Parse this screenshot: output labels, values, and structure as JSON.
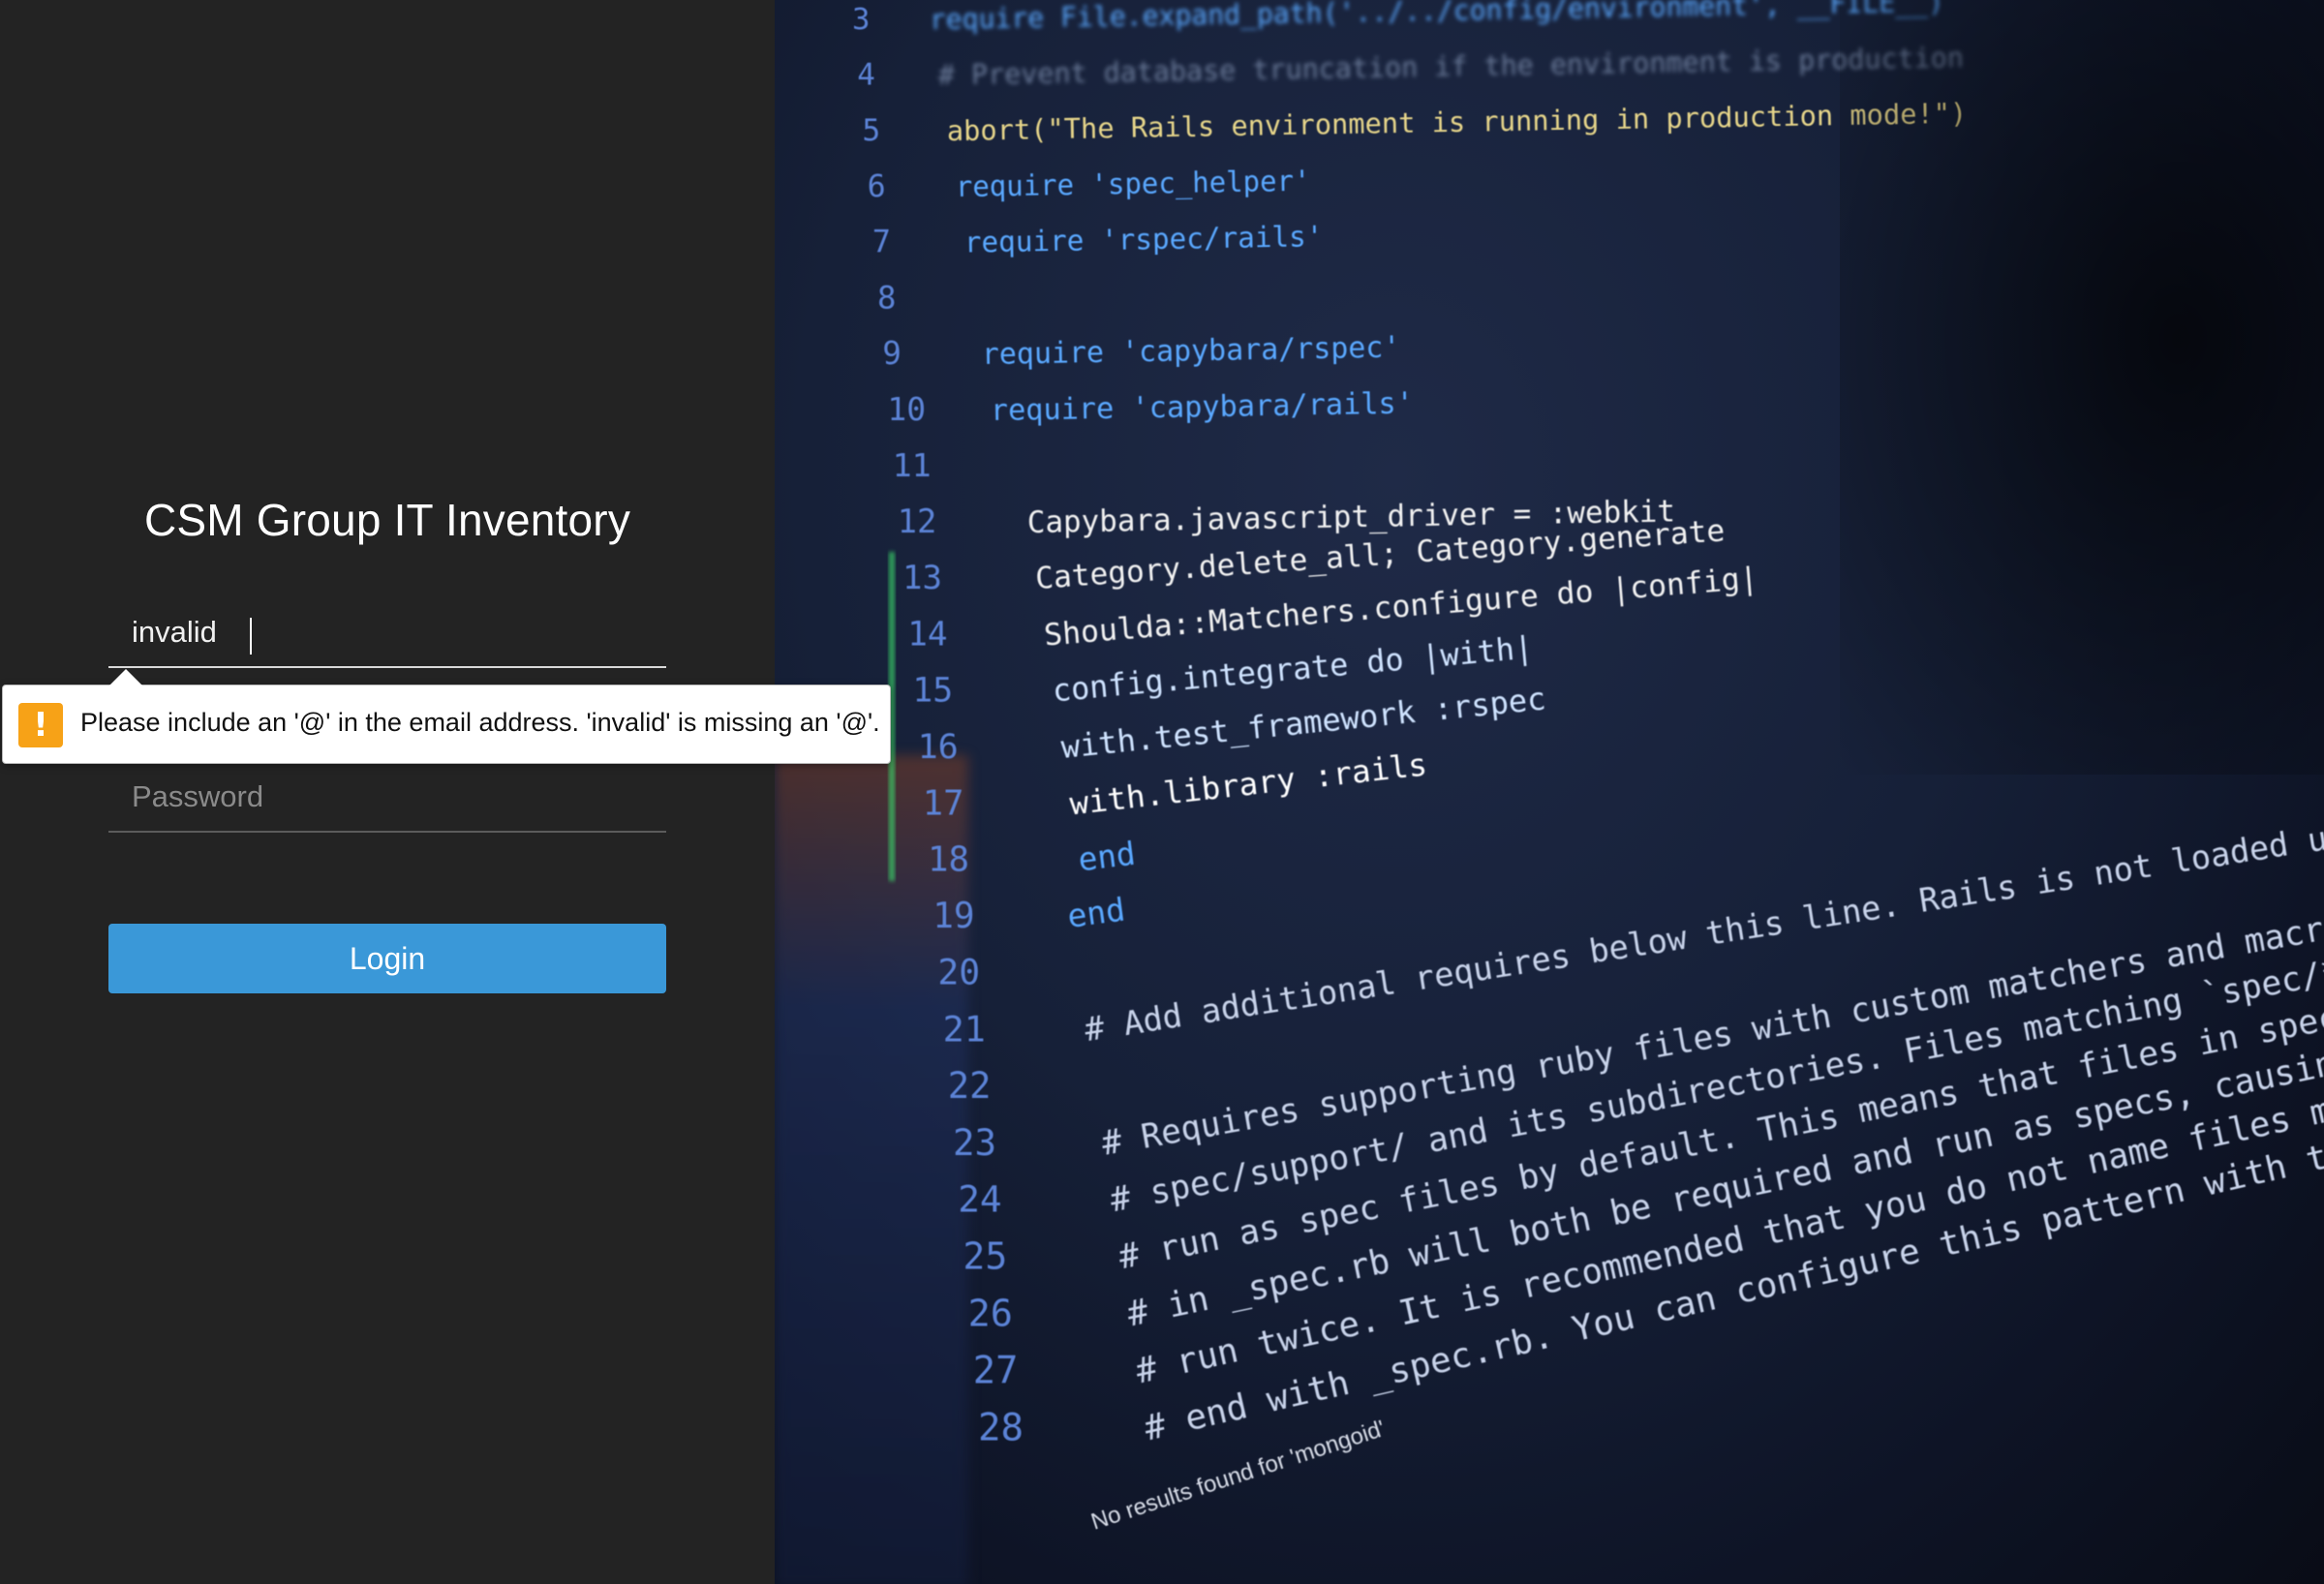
{
  "login": {
    "title": "CSM Group IT Inventory",
    "email_value": "invalid",
    "password_placeholder": "Password",
    "login_label": "Login"
  },
  "validation": {
    "message": "Please include an '@' in the email address. 'invalid' is missing an '@'.",
    "icon": "warning-icon",
    "icon_glyph": "!",
    "icon_color": "#f7a217"
  },
  "background_code": {
    "lines": [
      {
        "n": "3",
        "text": "require File.expand_path('../../config/environment', __FILE__)",
        "color": "#5aa8ff"
      },
      {
        "n": "4",
        "text": "# Prevent database truncation if the environment is production",
        "color": "#6a7a99"
      },
      {
        "n": "5",
        "text": "abort(\"The Rails environment is running in production mode!\")",
        "color": "#e7d68a"
      },
      {
        "n": "6",
        "text": "require 'spec_helper'",
        "color": "#5aa8ff"
      },
      {
        "n": "7",
        "text": "require 'rspec/rails'",
        "color": "#5aa8ff"
      },
      {
        "n": "8",
        "text": "",
        "color": "#5aa8ff"
      },
      {
        "n": "9",
        "text": "require 'capybara/rspec'",
        "color": "#5aa8ff"
      },
      {
        "n": "10",
        "text": "require 'capybara/rails'",
        "color": "#5aa8ff"
      },
      {
        "n": "11",
        "text": "",
        "color": "#5aa8ff"
      },
      {
        "n": "12",
        "text": "Capybara.javascript_driver = :webkit",
        "color": "#f2f2f2"
      },
      {
        "n": "13",
        "text": "Category.delete_all; Category.generate",
        "color": "#f2f2f2"
      },
      {
        "n": "14",
        "text": "Shoulda::Matchers.configure do |config|",
        "color": "#f2f2f2"
      },
      {
        "n": "15",
        "text": "config.integrate do |with|",
        "color": "#cfe3ff"
      },
      {
        "n": "16",
        "text": "with.test_framework :rspec",
        "color": "#cfe3ff"
      },
      {
        "n": "17",
        "text": "with.library :rails",
        "color": "#ffffff"
      },
      {
        "n": "18",
        "text": "end",
        "color": "#5aa8ff"
      },
      {
        "n": "19",
        "text": "end",
        "color": "#5aa8ff"
      },
      {
        "n": "20",
        "text": "",
        "color": "#5aa8ff"
      },
      {
        "n": "21",
        "text": "# Add additional requires below this line. Rails is not loaded until this point!",
        "color": "#c8d3ea"
      },
      {
        "n": "22",
        "text": "",
        "color": "#5aa8ff"
      },
      {
        "n": "23",
        "text": "# Requires supporting ruby files with custom matchers and macros, etc, in",
        "color": "#c8d3ea"
      },
      {
        "n": "24",
        "text": "# spec/support/ and its subdirectories. Files matching `spec/**/*_spec.rb` are",
        "color": "#c8d3ea"
      },
      {
        "n": "25",
        "text": "# run as spec files by default. This means that files in spec/support that end",
        "color": "#c8d3ea"
      },
      {
        "n": "26",
        "text": "# in _spec.rb will both be required and run as specs, causing the specs to be",
        "color": "#c8d3ea"
      },
      {
        "n": "27",
        "text": "# run twice. It is recommended that you do not name files matching this glob to",
        "color": "#c8d3ea"
      },
      {
        "n": "28",
        "text": "# end with _spec.rb. You can configure this pattern with the --pattern",
        "color": "#c8d3ea"
      }
    ],
    "status_text": "No results found for 'mongoid'",
    "colors": {
      "line_number": "#5b83d6",
      "green_accent": "#3bd66b",
      "orange_accent": "#f08a24"
    }
  }
}
